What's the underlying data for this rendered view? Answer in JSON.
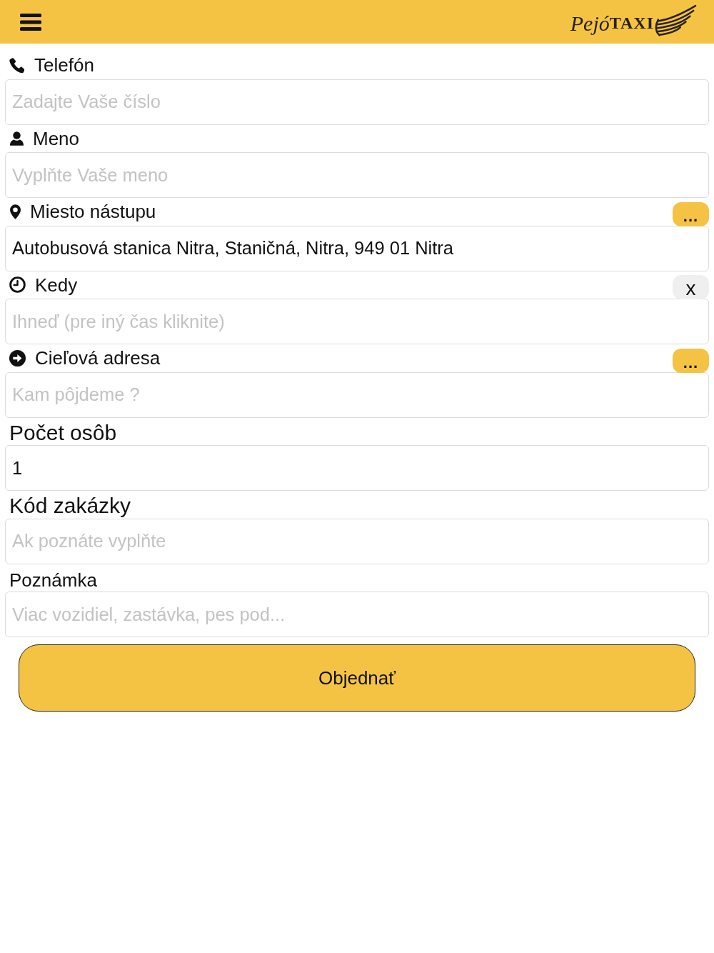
{
  "header": {
    "logo": {
      "script": "Pejó",
      "word": "TAXI"
    }
  },
  "fields": [
    {
      "kind": "iconed",
      "label": "Telefón",
      "placeholder": "Zadajte Vaše číslo"
    },
    {
      "kind": "iconed",
      "label": "Meno",
      "placeholder": "Vyplňte Vaše meno"
    },
    {
      "kind": "iconed",
      "label": "Miesto nástupu",
      "value": "Autobusová stanica Nitra, Staničná, Nitra, 949 01 Nitra",
      "action": {
        "kind": "pick",
        "text": "..."
      }
    },
    {
      "kind": "iconed",
      "label": "Kedy",
      "placeholder": "Ihneď (pre iný čas kliknite)",
      "action": {
        "kind": "clear",
        "text": "x"
      }
    },
    {
      "kind": "iconed",
      "label": "Cieľová adresa",
      "placeholder": "Kam pôjdeme ?",
      "action": {
        "kind": "pick",
        "text": "..."
      }
    },
    {
      "kind": "large",
      "label": "Počet osôb",
      "value": "1"
    },
    {
      "kind": "large",
      "label": "Kód zakázky",
      "placeholder": "Ak poznáte vyplňte"
    },
    {
      "kind": "plain",
      "label": "Poznámka",
      "placeholder": "Viac vozidiel, zastávka, pes pod..."
    }
  ],
  "submit": {
    "label": "Objednať"
  }
}
